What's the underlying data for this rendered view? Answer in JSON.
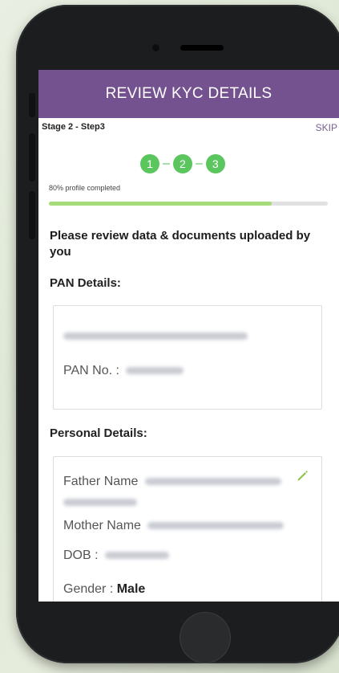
{
  "app": {
    "title": "REVIEW KYC DETAILS",
    "stage_label": "Stage 2 - Step3",
    "skip_label": "SKIP"
  },
  "steps": [
    "1",
    "2",
    "3"
  ],
  "progress": {
    "label": "80% profile completed",
    "percent": 80
  },
  "review_text": "Please review data & documents uploaded by you",
  "pan": {
    "title": "PAN Details:",
    "number_label": "PAN No. :"
  },
  "personal": {
    "title": "Personal Details:",
    "father_label": "Father Name",
    "mother_label": "Mother Name",
    "dob_label": "DOB :",
    "gender_label": "Gender :",
    "gender_value": "Male"
  },
  "colors": {
    "header": "#74518f",
    "step": "#5cc65e",
    "progress": "#a6dc7a",
    "edit": "#8bc34a"
  },
  "icons": {
    "edit": "pencil-icon"
  }
}
